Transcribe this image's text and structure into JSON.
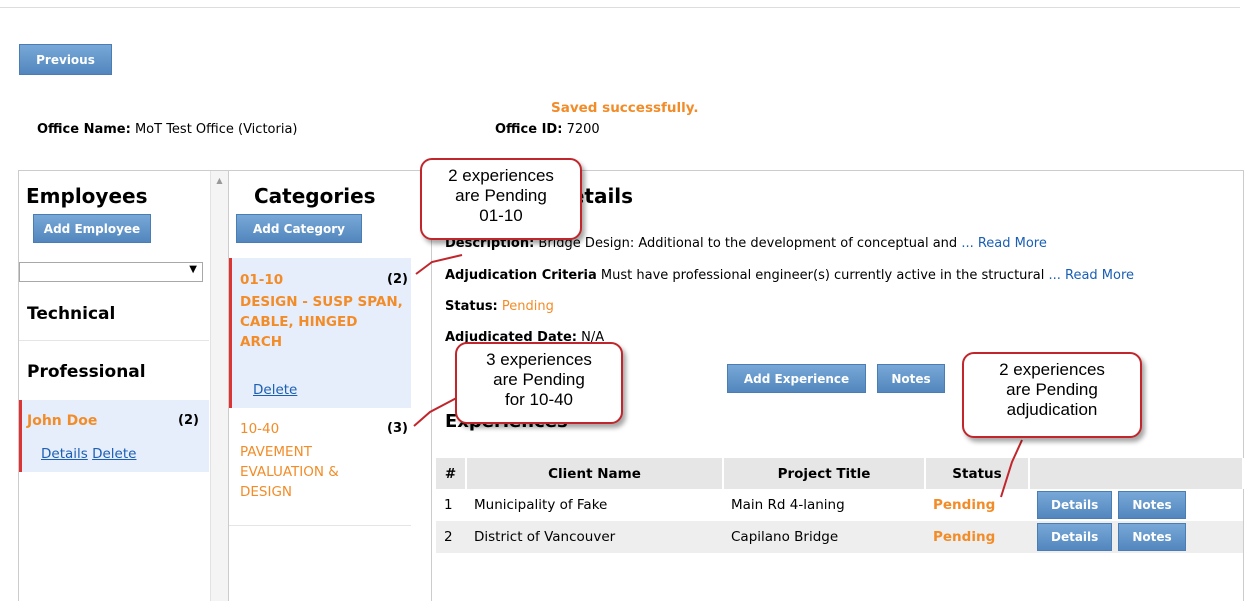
{
  "top": {
    "previous_label": "Previous",
    "saved_message": "Saved successfully.",
    "office_name_label": "Office Name:",
    "office_name_value": "MoT Test Office (Victoria)",
    "office_id_label": "Office ID:",
    "office_id_value": "7200"
  },
  "employees": {
    "title": "Employees",
    "add_label": "Add Employee",
    "select_value": "",
    "groups": [
      "Technical",
      "Professional"
    ],
    "selected": {
      "name": "John Doe",
      "count": "(2)",
      "details_label": "Details",
      "delete_label": "Delete"
    }
  },
  "categories": {
    "title": "Categories",
    "add_label": "Add Category",
    "items": [
      {
        "code": "01-10",
        "count": "(2)",
        "name_lines": [
          "DESIGN - SUSP SPAN,",
          "CABLE, HINGED",
          "ARCH"
        ],
        "delete_label": "Delete"
      },
      {
        "code": "10-40",
        "count": "(3)",
        "name_lines": [
          "PAVEMENT",
          "EVALUATION &",
          "DESIGN"
        ]
      }
    ]
  },
  "details": {
    "title": "Category Details",
    "description_label": "Description:",
    "description_text": "Bridge Design: Additional to the development of conceptual and",
    "read_more": "... Read More",
    "criteria_label": "Adjudication Criteria",
    "criteria_text": "Must have professional engineer(s) currently active in the structural",
    "status_label": "Status:",
    "status_value": "Pending",
    "adjudicated_label": "Adjudicated Date:",
    "adjudicated_value": "N/A",
    "add_experience_label": "Add Experience",
    "notes_label": "Notes",
    "experiences_title": "Experiences"
  },
  "table": {
    "headers": [
      "#",
      "Client Name",
      "Project Title",
      "Status",
      ""
    ],
    "rows": [
      {
        "num": "1",
        "client": "Municipality of Fake",
        "project": "Main Rd 4-laning",
        "status": "Pending",
        "details": "Details",
        "notes": "Notes"
      },
      {
        "num": "2",
        "client": "District of Vancouver",
        "project": "Capilano Bridge",
        "status": "Pending",
        "details": "Details",
        "notes": "Notes"
      }
    ]
  },
  "callouts": {
    "c1": [
      "2 experiences",
      "are Pending",
      "01-10"
    ],
    "c2": [
      "3 experiences",
      "are Pending",
      "for 10-40"
    ],
    "c3": [
      "2 experiences",
      "are Pending",
      "adjudication"
    ]
  },
  "colors": {
    "accent_orange": "#f28c28",
    "button_blue": "#5f93c8",
    "callout_red": "#c0262b",
    "link_blue": "#1a5fb4"
  }
}
